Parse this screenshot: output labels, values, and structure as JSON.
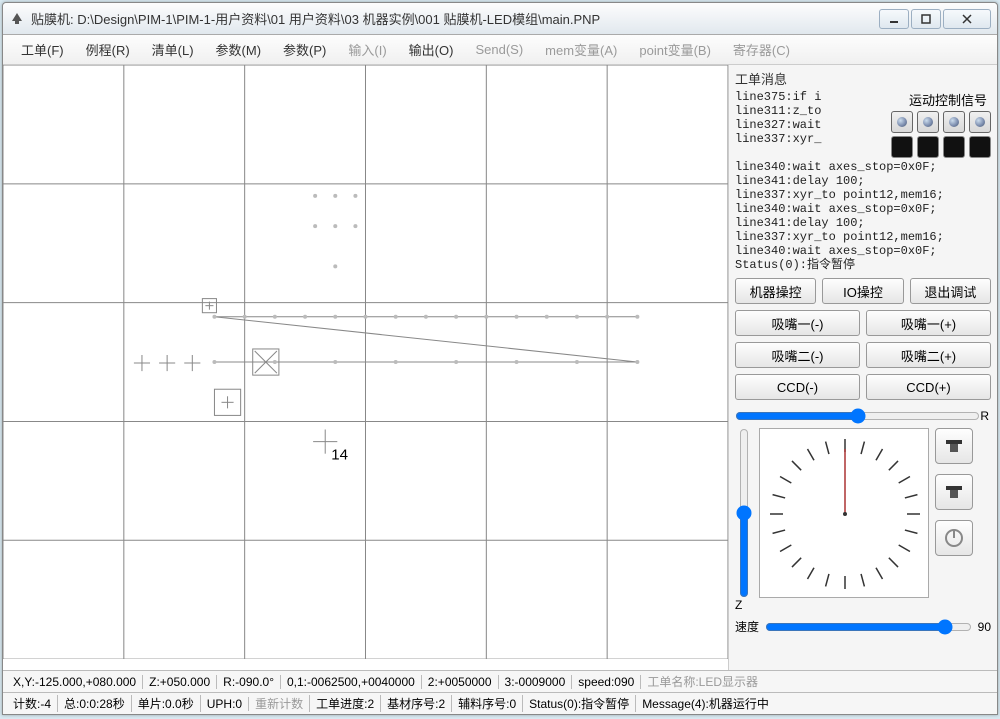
{
  "window": {
    "title": "贴膜机: D:\\Design\\PIM-1\\PIM-1-用户资料\\01 用户资料\\03 机器实例\\001 贴膜机-LED模组\\main.PNP"
  },
  "menu": {
    "items": [
      {
        "label": "工单(F)",
        "enabled": true
      },
      {
        "label": "例程(R)",
        "enabled": true
      },
      {
        "label": "清单(L)",
        "enabled": true
      },
      {
        "label": "参数(M)",
        "enabled": true
      },
      {
        "label": "参数(P)",
        "enabled": true
      },
      {
        "label": "输入(I)",
        "enabled": false
      },
      {
        "label": "输出(O)",
        "enabled": true
      },
      {
        "label": "Send(S)",
        "enabled": false
      },
      {
        "label": "mem变量(A)",
        "enabled": false
      },
      {
        "label": "point变量(B)",
        "enabled": false
      },
      {
        "label": "寄存器(C)",
        "enabled": false
      }
    ]
  },
  "canvas": {
    "cursor_label": "14"
  },
  "side": {
    "title": "工单消息",
    "motion_label": "运动控制信号",
    "log_lines": [
      "line375:if i",
      "line311:z_to",
      "line327:wait",
      "line337:xyr_",
      "line340:wait axes_stop=0x0F;",
      "line341:delay 100;",
      "line337:xyr_to point12,mem16;",
      "line340:wait axes_stop=0x0F;",
      "line341:delay 100;",
      "line337:xyr_to point12,mem16;",
      "line340:wait axes_stop=0x0F;",
      "Status(0):指令暂停"
    ],
    "row1": {
      "a": "机器操控",
      "b": "IO操控",
      "c": "退出调试"
    },
    "row2": {
      "a": "吸嘴一(-)",
      "b": "吸嘴一(+)"
    },
    "row3": {
      "a": "吸嘴二(-)",
      "b": "吸嘴二(+)"
    },
    "row4": {
      "a": "CCD(-)",
      "b": "CCD(+)"
    },
    "r_label": "R",
    "z_label": "Z",
    "speed_label": "速度",
    "speed_value": "90"
  },
  "status1": {
    "xy": "X,Y:-125.000,+080.000",
    "z": "Z:+050.000",
    "r": "R:-090.0°",
    "p01": "0,1:-0062500,+0040000",
    "p2": "2:+0050000",
    "p3": "3:-0009000",
    "speed": "speed:090",
    "name": "工单名称:LED显示器"
  },
  "status2": {
    "count": "计数:-4",
    "total": "总:0:0:28秒",
    "single": "单片:0.0秒",
    "uph": "UPH:0",
    "recount": "重新计数",
    "progress": "工单进度:2",
    "base": "基材序号:2",
    "aux": "辅料序号:0",
    "status": "Status(0):指令暂停",
    "msg": "Message(4):机器运行中"
  }
}
